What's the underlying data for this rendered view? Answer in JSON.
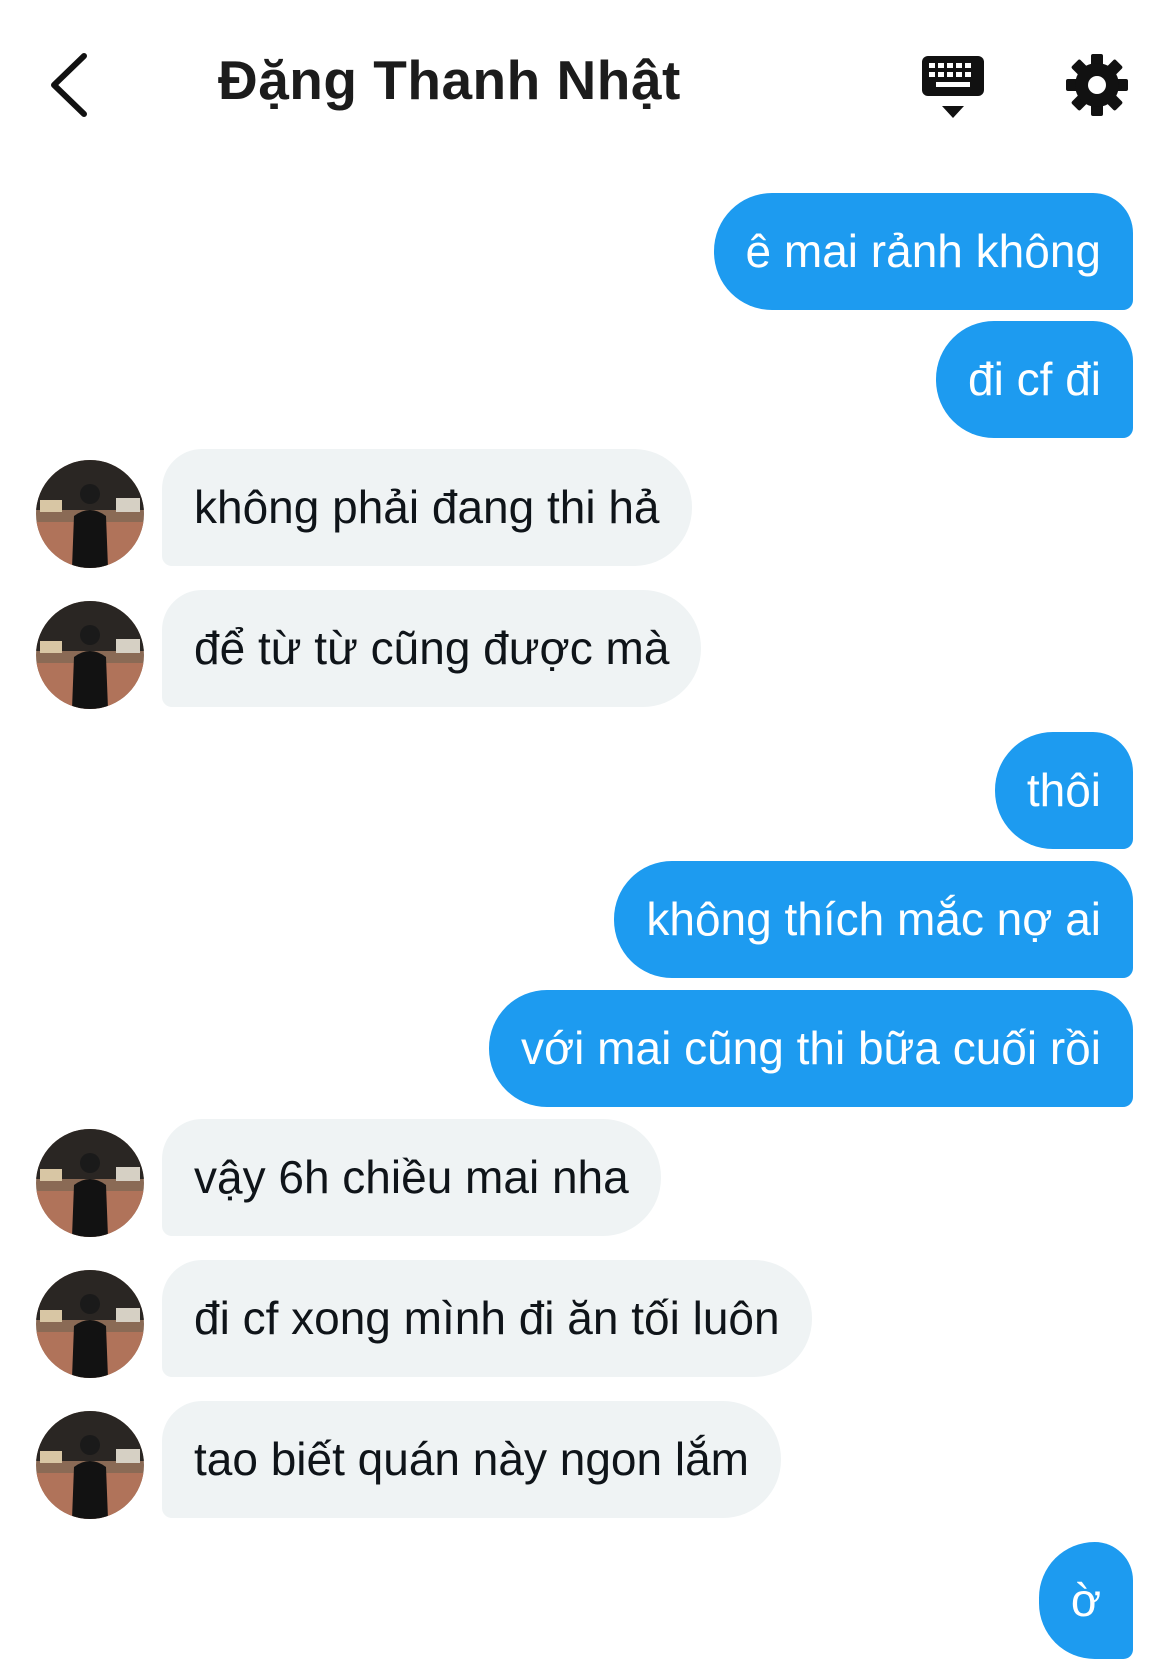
{
  "header": {
    "title": "Đặng Thanh Nhật",
    "back_icon": "chevron-left-icon",
    "keyboard_icon": "keyboard-icon",
    "settings_icon": "gear-icon"
  },
  "colors": {
    "outgoing_bubble": "#1d9bf0",
    "incoming_bubble": "#eff3f4"
  },
  "messages": [
    {
      "from": "me",
      "text": "ê mai rảnh không"
    },
    {
      "from": "me",
      "text": "đi cf đi"
    },
    {
      "from": "them",
      "text": "không phải đang thi hả"
    },
    {
      "from": "them",
      "text": "để từ từ cũng được mà"
    },
    {
      "from": "me",
      "text": "thôi"
    },
    {
      "from": "me",
      "text": "không thích mắc nợ ai"
    },
    {
      "from": "me",
      "text": "với mai cũng thi bữa cuối rồi"
    },
    {
      "from": "them",
      "text": "vậy 6h chiều mai nha"
    },
    {
      "from": "them",
      "text": "đi cf xong mình đi ăn tối luôn"
    },
    {
      "from": "them",
      "text": "tao biết quán này ngon lắm"
    },
    {
      "from": "me",
      "text": "ờ"
    }
  ]
}
